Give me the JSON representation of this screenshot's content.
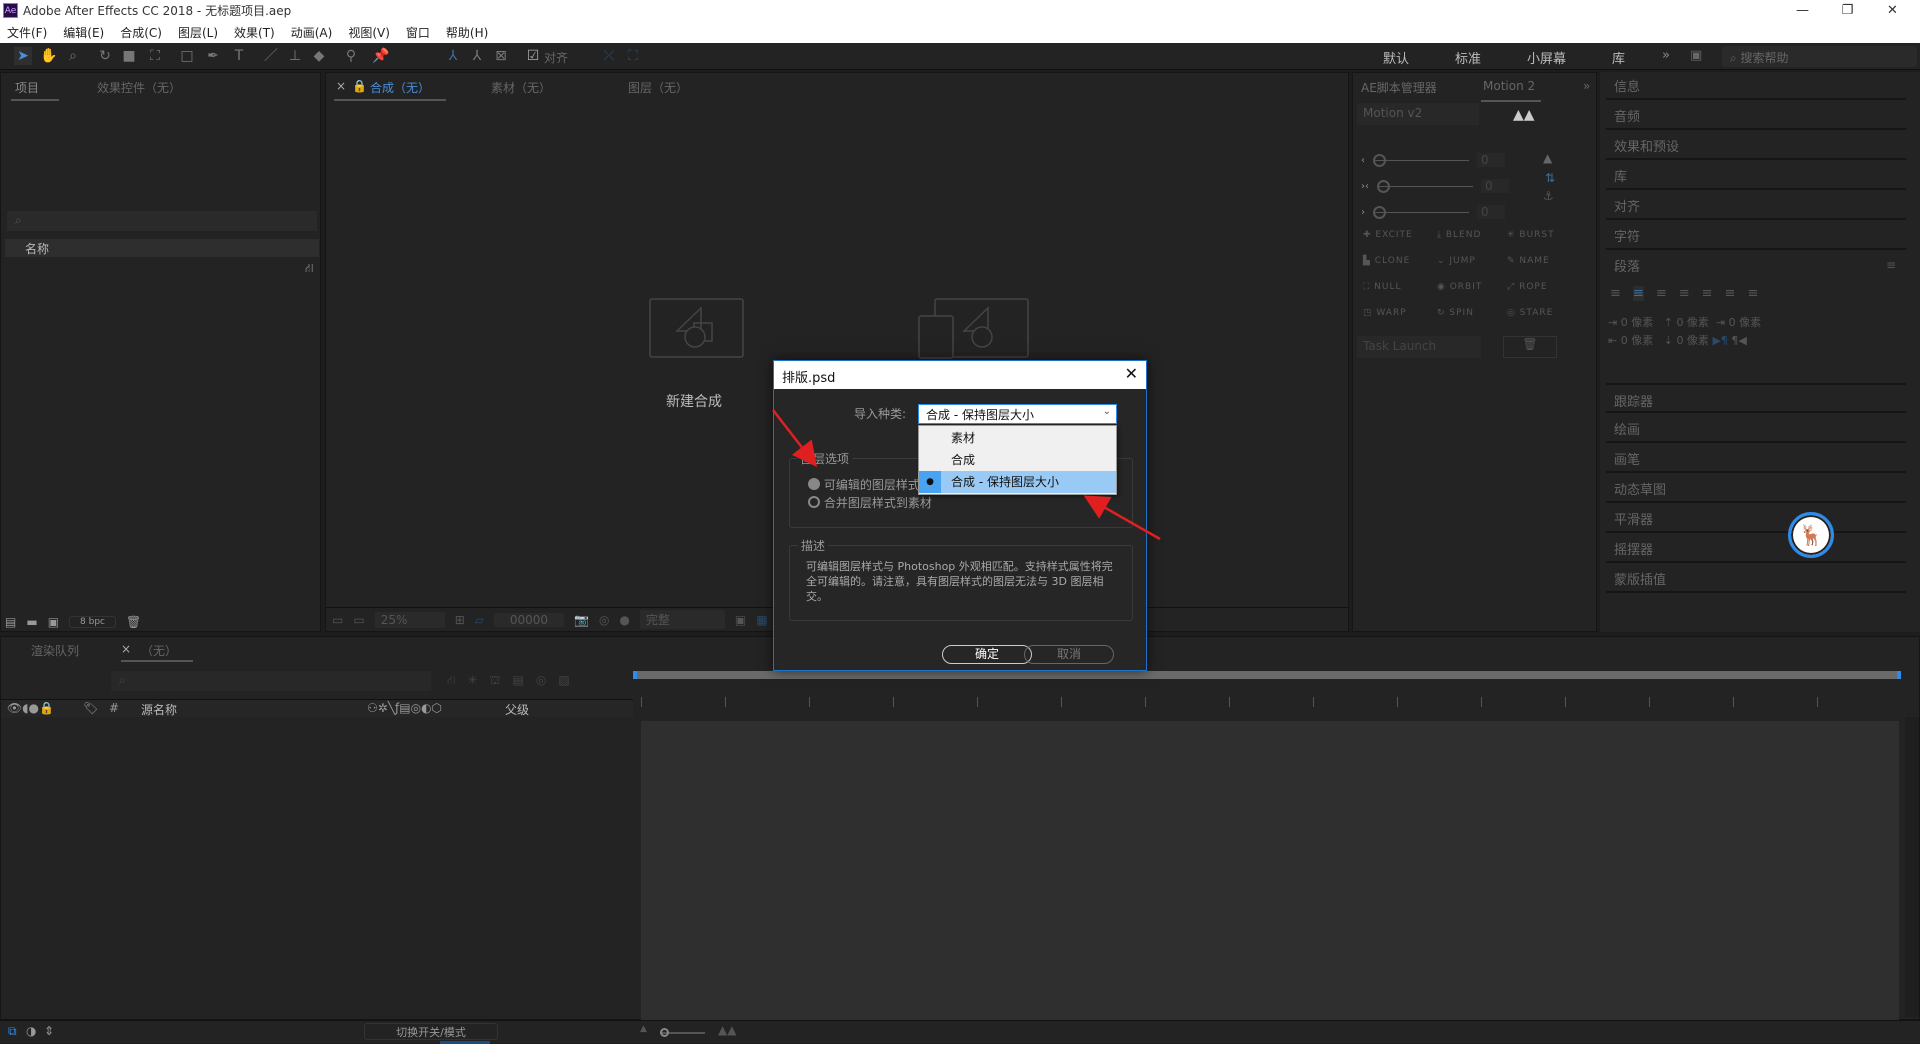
{
  "window": {
    "title": "Adobe After Effects CC 2018 - 无标题项目.aep",
    "app_icon": "Ae"
  },
  "menu": [
    "文件(F)",
    "编辑(E)",
    "合成(C)",
    "图层(L)",
    "效果(T)",
    "动画(A)",
    "视图(V)",
    "窗口",
    "帮助(H)"
  ],
  "toolbar": {
    "snap_label": "对齐",
    "workspaces": [
      "默认",
      "标准",
      "小屏幕",
      "库"
    ],
    "help_placeholder": "搜索帮助"
  },
  "project_panel": {
    "tabs": [
      "项目",
      "效果控件（无）"
    ],
    "column_name": "名称",
    "bpc": "8 bpc"
  },
  "comp_panel": {
    "tabs": [
      "合成（无）",
      "素材（无）",
      "图层（无）"
    ],
    "new_comp_label": "新建合成",
    "zoom": "25%",
    "timecode": "00000",
    "resolution": "完整"
  },
  "script_panel": {
    "tabs": [
      "AE脚本管理器",
      "Motion 2"
    ],
    "preset": "Motion v2",
    "slider_values": [
      "0",
      "0",
      "0"
    ],
    "buttons": [
      "EXCITE",
      "BLEND",
      "BURST",
      "CLONE",
      "JUMP",
      "NAME",
      "NULL",
      "ORBIT",
      "ROPE",
      "WARP",
      "SPIN",
      "STARE"
    ],
    "task": "Task Launch"
  },
  "right_panels": [
    "信息",
    "音频",
    "效果和预设",
    "库",
    "对齐",
    "字符",
    "段落",
    "跟踪器",
    "绘画",
    "画笔",
    "动态草图",
    "平滑器",
    "摇摆器",
    "蒙版插值"
  ],
  "paragraph": {
    "values": [
      "0 像素",
      "0 像素",
      "0 像素",
      "0 像素",
      "0 像素"
    ]
  },
  "timeline": {
    "tabs": [
      "渲染队列",
      "（无）"
    ],
    "columns": {
      "hash": "#",
      "source_name": "源名称",
      "parent": "父级"
    },
    "toggle_label": "切换开关/模式"
  },
  "dialog": {
    "title": "排版.psd",
    "import_kind_label": "导入种类:",
    "import_kind_value": "合成 - 保持图层大小",
    "options": [
      "素材",
      "合成",
      "合成 - 保持图层大小"
    ],
    "selected_option": 2,
    "layer_options_label": "图层选项",
    "radio1": "可编辑的图层样式",
    "radio2": "合并图层样式到素材",
    "description_label": "描述",
    "description": "可编辑图层样式与 Photoshop 外观相匹配。支持样式属性将完全可编辑的。请注意，具有图层样式的图层无法与 3D 图层相交。",
    "ok": "确定",
    "cancel": "取消"
  },
  "colors": {
    "accent": "#2d8ceb",
    "annotation_arrow": "#e02020",
    "selected_option_bg": "#99c9f5"
  }
}
